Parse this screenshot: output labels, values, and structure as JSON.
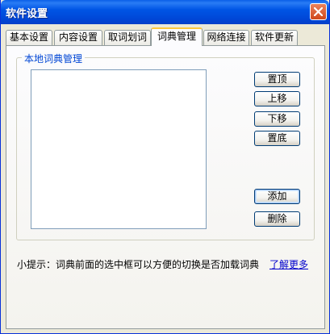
{
  "window": {
    "title": "软件设置"
  },
  "tabs": [
    {
      "label": "基本设置"
    },
    {
      "label": "内容设置"
    },
    {
      "label": "取词划词"
    },
    {
      "label": "词典管理",
      "active": true
    },
    {
      "label": "网络连接"
    },
    {
      "label": "软件更新"
    }
  ],
  "group": {
    "title": "本地词典管理"
  },
  "buttons": {
    "top": "置顶",
    "up": "上移",
    "down": "下移",
    "bottom": "置底",
    "add": "添加",
    "delete": "删除"
  },
  "hint": {
    "text": "小提示：词典前面的选中框可以方便的切换是否加载词典"
  },
  "link": {
    "text": "了解更多"
  }
}
